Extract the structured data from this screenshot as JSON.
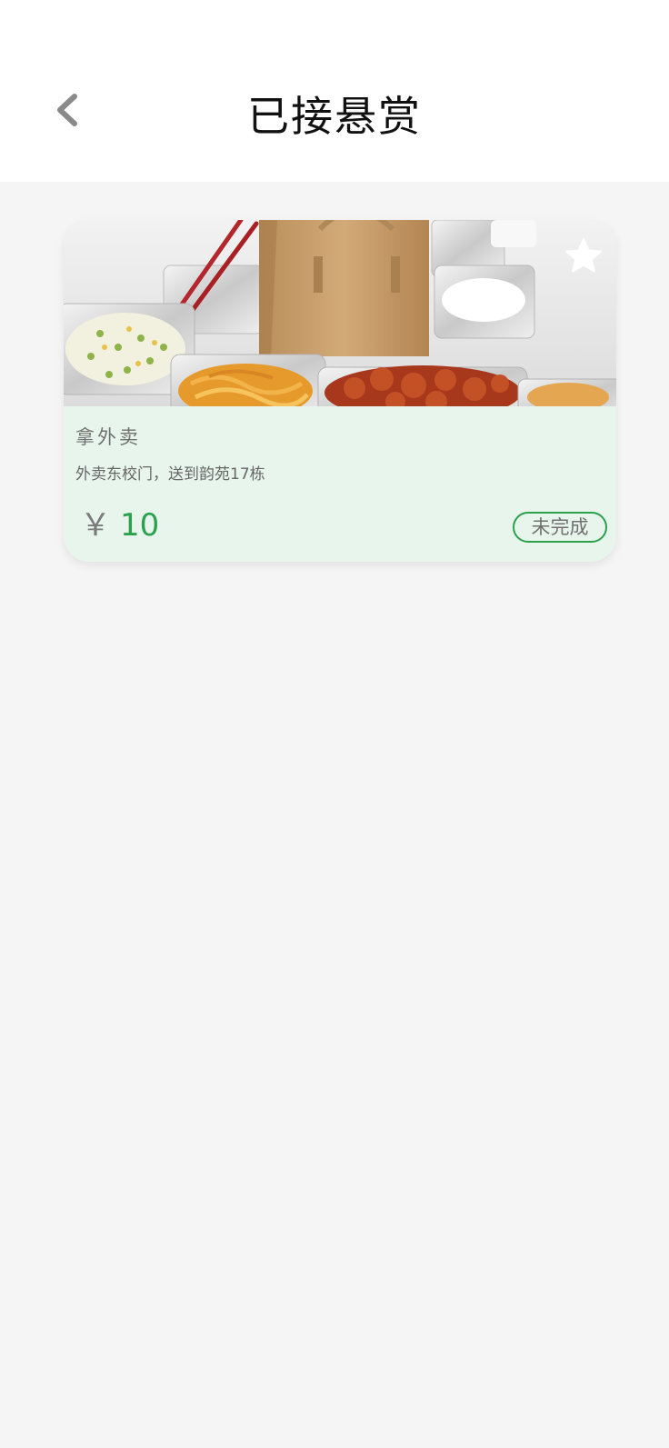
{
  "header": {
    "title": "已接悬赏",
    "back_icon": "chevron-left-icon"
  },
  "colors": {
    "accent": "#2ba14c",
    "card_bg": "#e8f5ec",
    "page_bg": "#f5f5f5"
  },
  "bounty": {
    "title": "拿外卖",
    "description": "外卖东校门，送到韵苑17栋",
    "currency_symbol": "￥",
    "reward": "10",
    "status": "未完成",
    "favorite_icon": "star-icon"
  }
}
